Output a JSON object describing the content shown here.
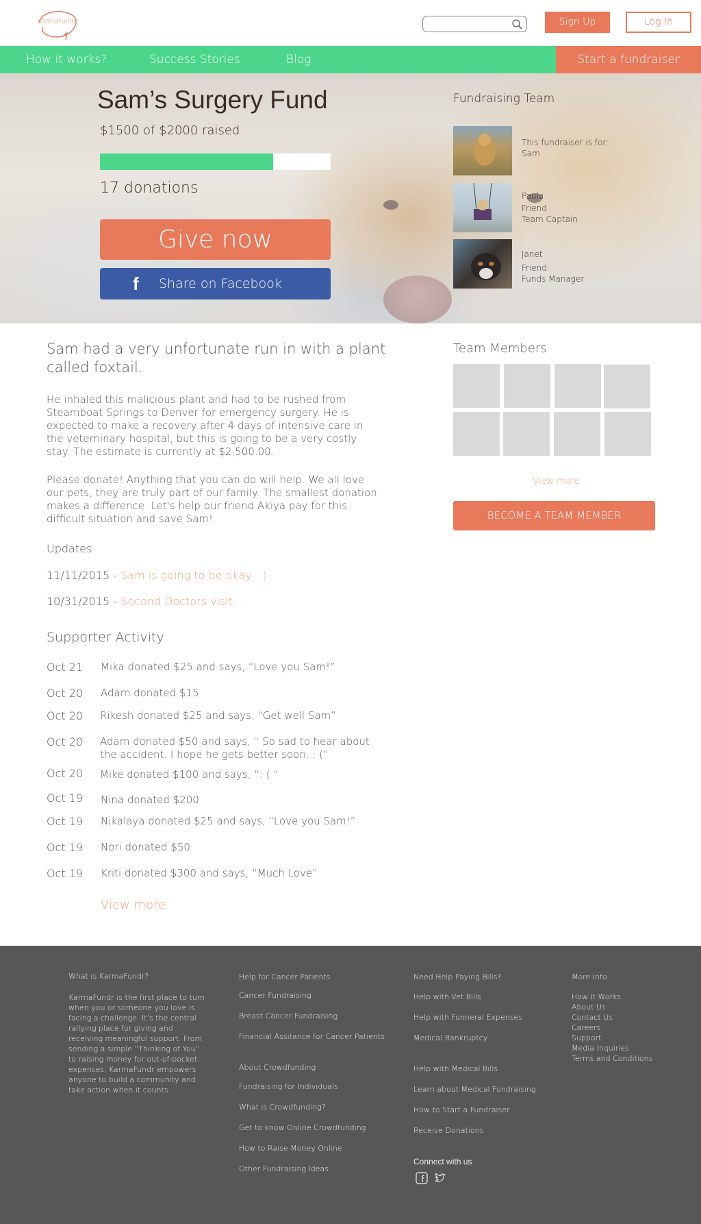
{
  "header": {
    "logo_text": "KarmaFundr",
    "search_placeholder": "",
    "signup_label": "Sign Up",
    "login_label": "Log In"
  },
  "nav": {
    "items": [
      "How it works?",
      "Success Stories",
      "Blog"
    ],
    "cta": "Start a fundraiser"
  },
  "hero": {
    "title": "Sam’s Surgery Fund",
    "raised_text": "$1500 of $2000 raised",
    "progress_fraction": 0.75,
    "donations_text": "17 donations",
    "give_label": "Give now",
    "fb_icon": "f",
    "fb_label": "Share on Facebook"
  },
  "fundraising_team": {
    "title": "Fundraising Team",
    "members": [
      {
        "lines": [
          "This fundraiser is for:",
          "Sam"
        ]
      },
      {
        "lines": [
          "Paula",
          "Friend",
          "Team Captain"
        ]
      },
      {
        "lines": [
          "Janet",
          "Friend",
          "Funds Manager"
        ]
      }
    ]
  },
  "story": {
    "lead": "Sam had a very unfortunate run in with a plant called foxtail.",
    "p1": "He inhaled this malicious plant and had to be rushed from Steamboat Springs to Denver for emergency surgery. He is expected to make a recovery after 4 days of intensive care in the veterninary hospital, but this is going to be a very costly stay. The estimate is currently at $2,500.00.",
    "p2": "Please donate! Anything that you can do will help. We all love our pets, they are truly part of our family. The smallest donation makes a difference. Let's help our friend Akiya pay for this difficult situation and save Sam!"
  },
  "updates": {
    "title": "Updates",
    "items": [
      {
        "date": "11/11/2015 - ",
        "link": "Sam is going to be okay : )"
      },
      {
        "date": "10/31/2015 - ",
        "link": "Second Doctors visit..."
      }
    ]
  },
  "supporter": {
    "title": "Supporter Activity",
    "items": [
      {
        "date": "Oct 21",
        "text": "Mika donated $25 and says, “Love you Sam!”"
      },
      {
        "date": "Oct 20",
        "text": "Adam donated $15"
      },
      {
        "date": "Oct 20",
        "text": "Rikesh donated $25 and says, “Get well Sam”"
      },
      {
        "date": "Oct 20",
        "text": "Adam donated $50 and says, “ So sad to hear about the accident. I hope he gets better soon. : (”"
      },
      {
        "date": "Oct 20",
        "text": "Mike donated $100 and says, “: ( “"
      },
      {
        "date": "Oct 19",
        "text": "Nina donated $200"
      },
      {
        "date": "Oct 19",
        "text": "Nikalaya donated $25 and says, “Love you Sam!”"
      },
      {
        "date": "Oct 19",
        "text": "Nori donated $50"
      },
      {
        "date": "Oct 19",
        "text": "Kriti donated $300 and says, “Much Love”"
      }
    ],
    "view_more": "View more"
  },
  "team_members": {
    "title": "Team Members",
    "view_more": "View more",
    "become_label": "BECOME A TEAM MEMBER"
  },
  "footer": {
    "col1": {
      "title": "What is KarmaFundr?",
      "body": "KarmaFundr is the first place to turn when you or someone you love is facing a challenge. It’s the central  rallying place for giving and receiving meaningful support. From sending a simple “Thinking of You” to raising money for out-of-pocket expenses, KarmaFundr empowers anyone to  build a community and take action when it counts."
    },
    "col2": {
      "title": "Help for Cancer Patients",
      "links": [
        "Cancer Fundraising",
        "Breast Cancer Fundraising",
        "Financial Assitance for Cancer Patients"
      ],
      "title2": "About Crowdfunding",
      "links2": [
        "Fundraising for Individuals",
        "What is Crowdfunding?",
        "Get to know Online Crowdfunding",
        "How to Raise Money Online",
        "Other Fundraising Ideas"
      ]
    },
    "col3": {
      "title": "Need Help Paying Bills?",
      "links": [
        "Help with Vet Bills",
        "Help with Funneral Expenses",
        "Medical Bankruptcy"
      ],
      "title2": "Help with Medical Bills",
      "links2": [
        "Learn about Medical Fundraising",
        "How to Start a Fundraiser",
        "Receive Donations"
      ],
      "connect": "Connect with us",
      "icons": [
        "facebook-icon",
        "twitter-icon"
      ]
    },
    "col4": {
      "title": "More Info",
      "links": [
        "How It Works",
        "About Us",
        "Contact Us",
        "Careers",
        "Support",
        "Media Inquiries",
        "Terms and Conditions"
      ]
    }
  },
  "colors": {
    "brand_orange": "#e8795a",
    "brand_green": "#4cd68b",
    "facebook_blue": "#3b5ba5",
    "footer_gray": "#575757"
  }
}
